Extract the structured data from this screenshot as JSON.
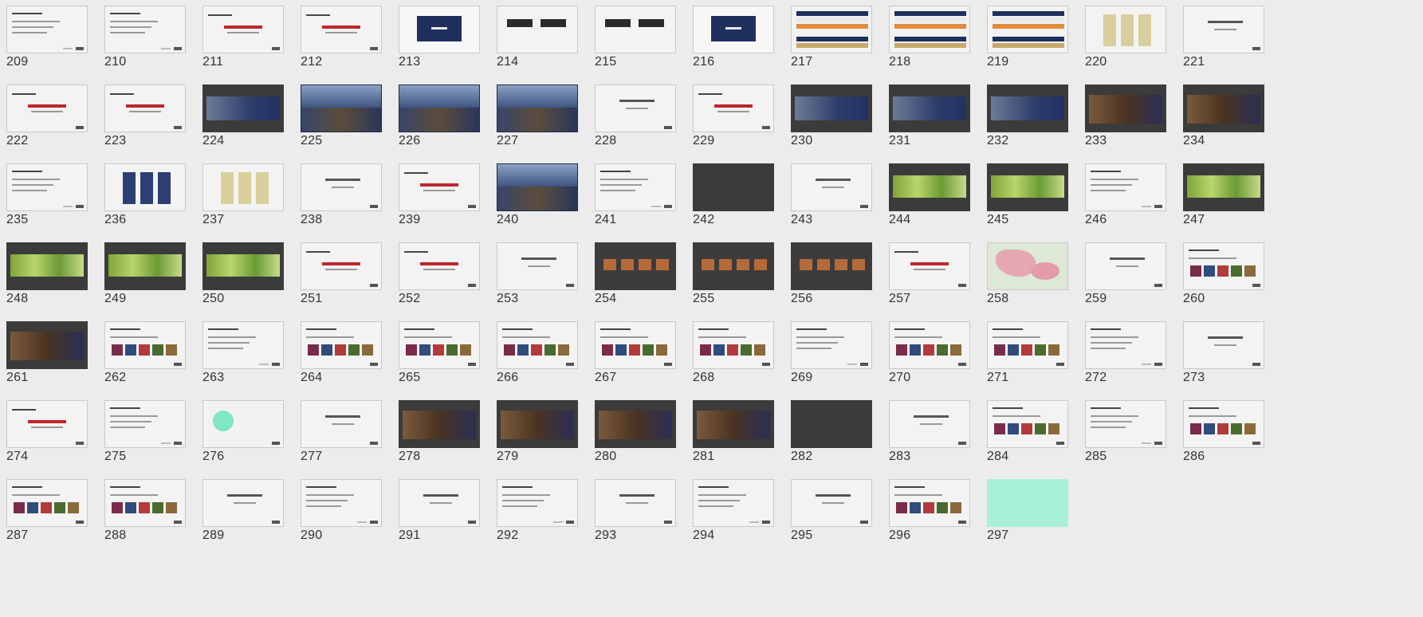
{
  "slides": [
    {
      "num": "209",
      "style": "text"
    },
    {
      "num": "210",
      "style": "text"
    },
    {
      "num": "211",
      "style": "red"
    },
    {
      "num": "212",
      "style": "red"
    },
    {
      "num": "213",
      "style": "navy"
    },
    {
      "num": "214",
      "style": "logo"
    },
    {
      "num": "215",
      "style": "logo"
    },
    {
      "num": "216",
      "style": "navy"
    },
    {
      "num": "217",
      "style": "stripes"
    },
    {
      "num": "218",
      "style": "stripes"
    },
    {
      "num": "219",
      "style": "stripes"
    },
    {
      "num": "220",
      "style": "posters-beige"
    },
    {
      "num": "221",
      "style": "center"
    },
    {
      "num": "222",
      "style": "red"
    },
    {
      "num": "223",
      "style": "red"
    },
    {
      "num": "224",
      "style": "dark"
    },
    {
      "num": "225",
      "style": "photo"
    },
    {
      "num": "226",
      "style": "photo"
    },
    {
      "num": "227",
      "style": "photo"
    },
    {
      "num": "228",
      "style": "center"
    },
    {
      "num": "229",
      "style": "red"
    },
    {
      "num": "230",
      "style": "dark"
    },
    {
      "num": "231",
      "style": "dark"
    },
    {
      "num": "232",
      "style": "dark"
    },
    {
      "num": "233",
      "style": "dark2"
    },
    {
      "num": "234",
      "style": "dark2"
    },
    {
      "num": "235",
      "style": "text"
    },
    {
      "num": "236",
      "style": "posters"
    },
    {
      "num": "237",
      "style": "posters-beige"
    },
    {
      "num": "238",
      "style": "center"
    },
    {
      "num": "239",
      "style": "red"
    },
    {
      "num": "240",
      "style": "photo"
    },
    {
      "num": "241",
      "style": "text"
    },
    {
      "num": "242",
      "style": "dark-plain"
    },
    {
      "num": "243",
      "style": "center"
    },
    {
      "num": "244",
      "style": "green"
    },
    {
      "num": "245",
      "style": "green"
    },
    {
      "num": "246",
      "style": "text"
    },
    {
      "num": "247",
      "style": "green"
    },
    {
      "num": "248",
      "style": "green"
    },
    {
      "num": "249",
      "style": "green"
    },
    {
      "num": "250",
      "style": "green"
    },
    {
      "num": "251",
      "style": "red"
    },
    {
      "num": "252",
      "style": "red"
    },
    {
      "num": "253",
      "style": "center"
    },
    {
      "num": "254",
      "style": "grey"
    },
    {
      "num": "255",
      "style": "grey"
    },
    {
      "num": "256",
      "style": "grey"
    },
    {
      "num": "257",
      "style": "red"
    },
    {
      "num": "258",
      "style": "map"
    },
    {
      "num": "259",
      "style": "center"
    },
    {
      "num": "260",
      "style": "pics"
    },
    {
      "num": "261",
      "style": "dark2"
    },
    {
      "num": "262",
      "style": "pics"
    },
    {
      "num": "263",
      "style": "text"
    },
    {
      "num": "264",
      "style": "pics"
    },
    {
      "num": "265",
      "style": "pics"
    },
    {
      "num": "266",
      "style": "pics"
    },
    {
      "num": "267",
      "style": "pics"
    },
    {
      "num": "268",
      "style": "pics"
    },
    {
      "num": "269",
      "style": "text"
    },
    {
      "num": "270",
      "style": "pics"
    },
    {
      "num": "271",
      "style": "pics"
    },
    {
      "num": "272",
      "style": "text"
    },
    {
      "num": "273",
      "style": "center"
    },
    {
      "num": "274",
      "style": "red"
    },
    {
      "num": "275",
      "style": "text"
    },
    {
      "num": "276",
      "style": "mint"
    },
    {
      "num": "277",
      "style": "center"
    },
    {
      "num": "278",
      "style": "dark2"
    },
    {
      "num": "279",
      "style": "dark2"
    },
    {
      "num": "280",
      "style": "dark2"
    },
    {
      "num": "281",
      "style": "dark2"
    },
    {
      "num": "282",
      "style": "dark-plain"
    },
    {
      "num": "283",
      "style": "center"
    },
    {
      "num": "284",
      "style": "pics"
    },
    {
      "num": "285",
      "style": "text"
    },
    {
      "num": "286",
      "style": "pics"
    },
    {
      "num": "287",
      "style": "pics"
    },
    {
      "num": "288",
      "style": "pics"
    },
    {
      "num": "289",
      "style": "center"
    },
    {
      "num": "290",
      "style": "text"
    },
    {
      "num": "291",
      "style": "center"
    },
    {
      "num": "292",
      "style": "text"
    },
    {
      "num": "293",
      "style": "center"
    },
    {
      "num": "294",
      "style": "text"
    },
    {
      "num": "295",
      "style": "center"
    },
    {
      "num": "296",
      "style": "pics"
    },
    {
      "num": "297",
      "style": "bright"
    }
  ],
  "colors": {
    "navy": "#1f2f5e",
    "red": "#c0262d",
    "mint": "#7fe6c6",
    "green": "#8fb845"
  }
}
